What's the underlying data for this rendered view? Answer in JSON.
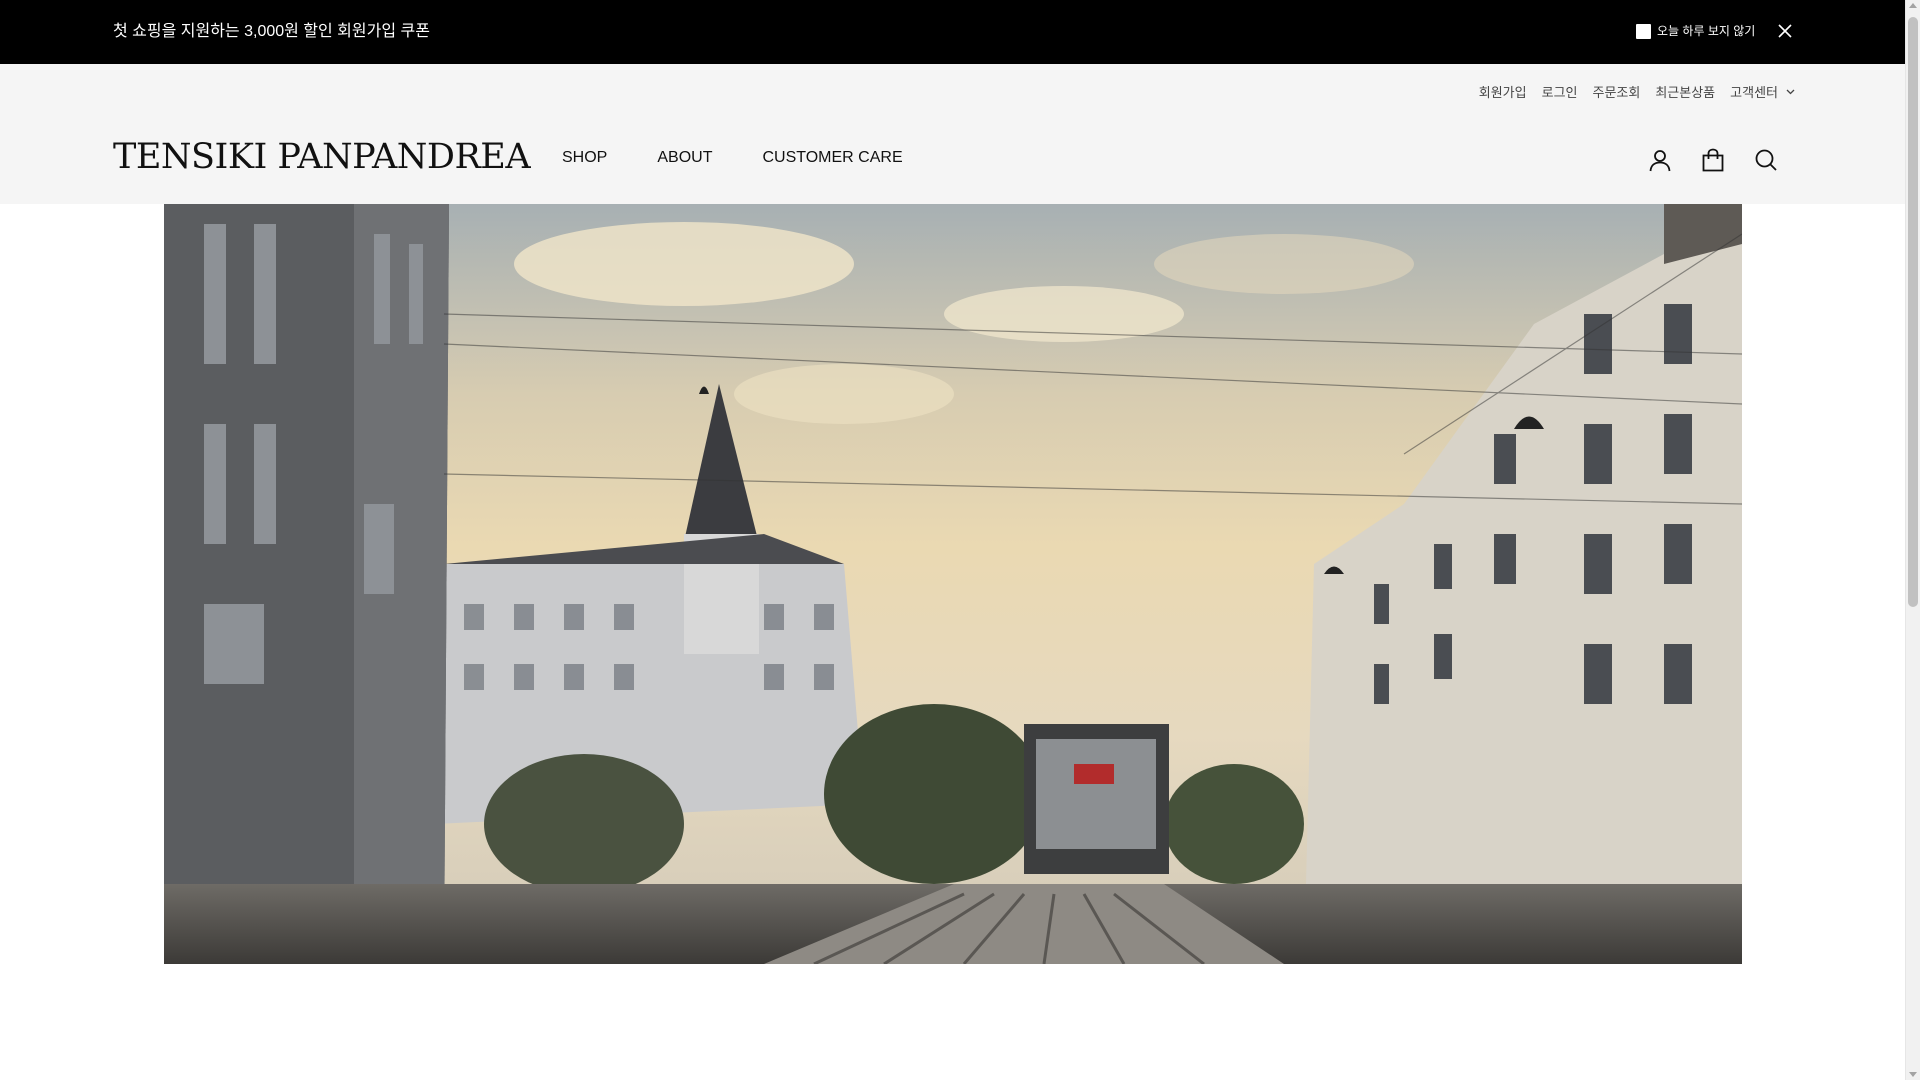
{
  "topbar": {
    "promo_text": "첫 쇼핑을 지원하는 3,000원 할인 회원가입 쿠폰",
    "hide_today_label": "오늘 하루 보지 않기"
  },
  "util_nav": {
    "signup": "회원가입",
    "login": "로그인",
    "order_lookup": "주문조회",
    "recent_items": "최근본상품",
    "customer_center": "고객센터"
  },
  "header": {
    "logo": "TENSIKI PANPANDREA",
    "nav": [
      "SHOP",
      "ABOUT",
      "CUSTOMER CARE"
    ]
  },
  "colors": {
    "topbar_bg": "#000000",
    "header_bg": "#f5f5f5"
  }
}
